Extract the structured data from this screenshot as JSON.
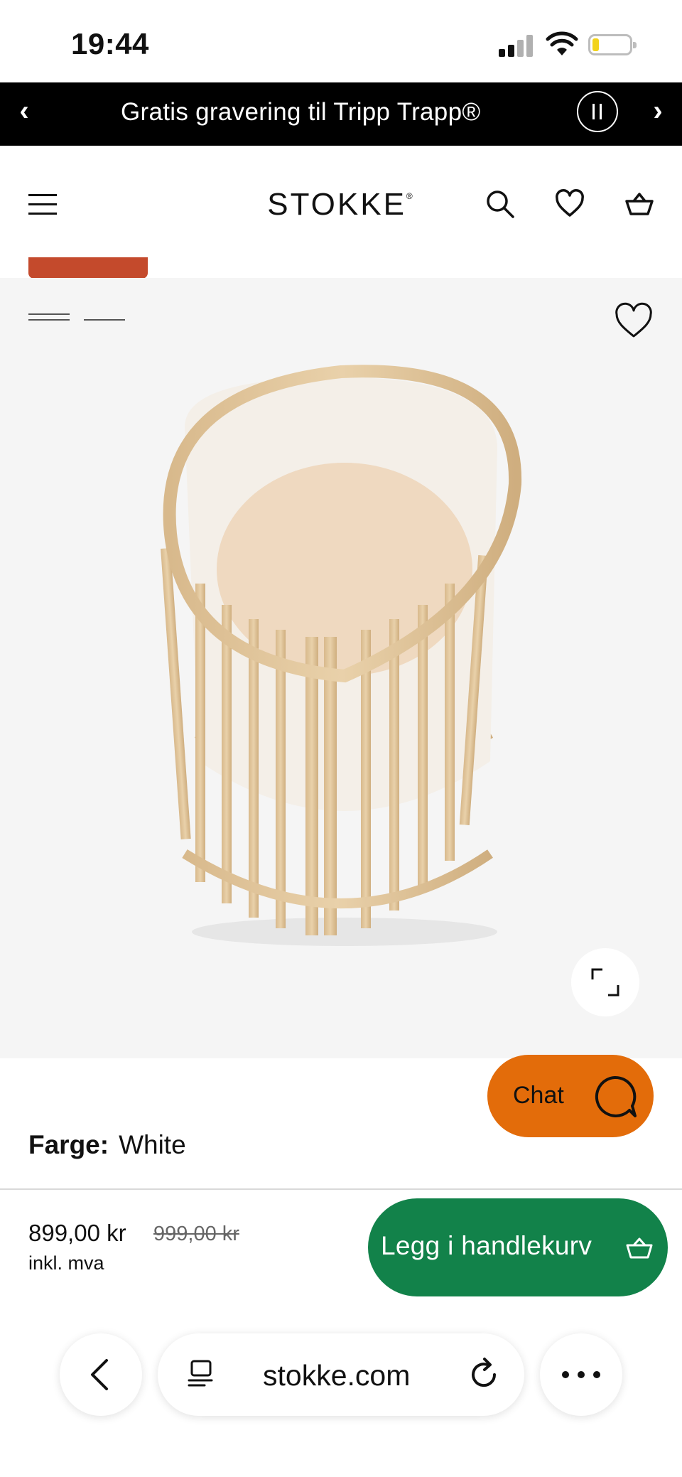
{
  "status_bar": {
    "time": "19:44"
  },
  "promo": {
    "text": "Gratis gravering til Tripp Trapp®",
    "prev": "‹",
    "next": "›"
  },
  "header": {
    "logo": "STOKKE",
    "logo_mark": "®"
  },
  "product": {
    "color_label": "Farge:",
    "color_value": "White",
    "price": "899,00 kr",
    "original_price": "999,00 kr",
    "vat_note": "inkl. mva",
    "add_to_cart": "Legg i handlekurv"
  },
  "chat": {
    "label": "Chat"
  },
  "browser": {
    "url": "stokke.com"
  },
  "colors": {
    "promo_bg": "#000000",
    "chat_bg": "#e36c0a",
    "cart_bg": "#12824a",
    "tag": "#c44a2c",
    "gallery_bg": "#f5f5f5"
  }
}
